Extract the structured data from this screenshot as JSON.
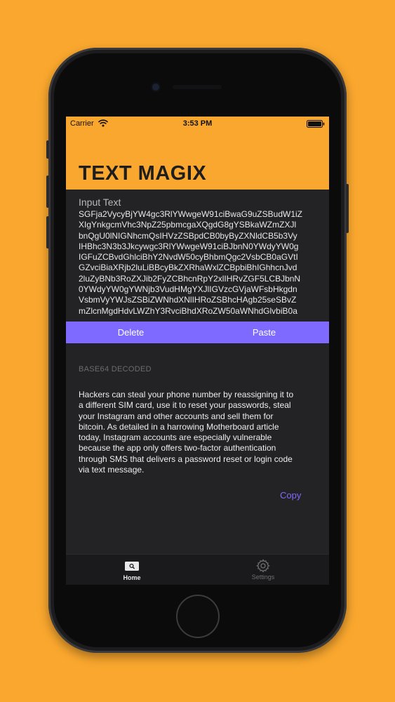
{
  "status_bar": {
    "carrier": "Carrier",
    "time": "3:53 PM"
  },
  "app": {
    "title": "TEXT MAGIX"
  },
  "input": {
    "label": "Input Text",
    "lines": [
      "SGFja2VycyBjYW4gc3RlYWwgeW91ciBwaG9uZSBudW1iZ",
      "XIgYnkgcmVhc3NpZ25pbmcgaXQgdG8gYSBkaWZmZXJl",
      "bnQgU0lNIGNhcmQsIHVzZSBpdCB0byByZXNldCB5b3Vy",
      "IHBhc3N3b3Jkcywgc3RlYWwgeW91ciBJbnN0YWdyYW0g",
      "IGFuZCBvdGhlciBhY2NvdW50cyBhbmQgc2VsbCB0aGVtI",
      "GZvciBiaXRjb2luLiBBcyBkZXRhaWxlZCBpbiBhIGhhcnJvd",
      "2luZyBNb3RoZXJib2FyZCBhcnRpY2xlIHRvZGF5LCBJbnN",
      "0YWdyYW0gYWNjb3VudHMgYXJlIGVzcGVjaWFsbHkgdn",
      "VsbmVyYWJsZSBiZWNhdXNlIHRoZSBhcHAgb25seSBvZ",
      "mZlcnMgdHdvLWZhY3RvciBhdXRoZW50aWNhdGlvbiB0a"
    ]
  },
  "actions": {
    "delete_label": "Delete",
    "paste_label": "Paste"
  },
  "decoded": {
    "section_label": "BASE64 DECODED",
    "lines": [
      "Hackers can steal your phone number by reassigning it to",
      "a different SIM card, use it to reset your passwords, steal",
      "your Instagram  and other accounts and sell them for",
      "bitcoin. As detailed in a harrowing Motherboard article",
      "today, Instagram accounts are especially vulnerable",
      "because the app only offers two-factor authentication",
      "through SMS that delivers a password reset or login code",
      "via text message."
    ],
    "copy_label": "Copy"
  },
  "tab_bar": {
    "tabs": [
      {
        "label": "Home",
        "icon": "keyboard-search-icon",
        "selected": true
      },
      {
        "label": "Settings",
        "icon": "gear-icon",
        "selected": false
      }
    ]
  },
  "colors": {
    "accent": "#7F6AFF",
    "brand": "#F9A72E",
    "background": "#232325"
  }
}
